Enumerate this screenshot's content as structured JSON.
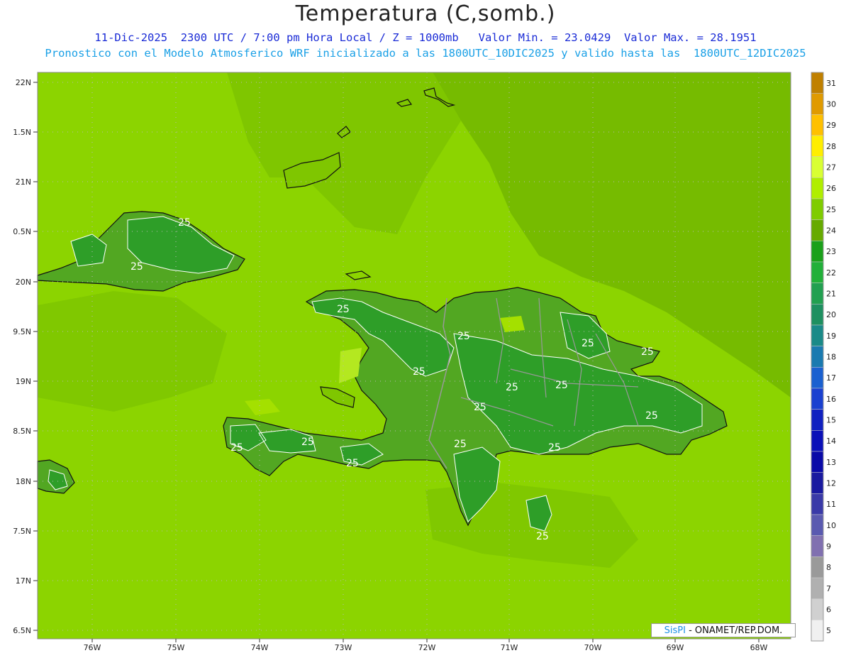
{
  "title": "Temperatura (C,somb.)",
  "subtitle1": "11-Dic-2025  2300 UTC / 7:00 pm Hora Local / Z = 1000mb   Valor Min. = 23.0429  Valor Max. = 28.1951",
  "subtitle2": "Pronostico con el Modelo Atmosferico WRF inicializado a las 1800UTC_10DIC2025 y valido hasta las  1800UTC_12DIC2025",
  "lat_ticks": [
    "22N",
    "1.5N",
    "21N",
    "0.5N",
    "20N",
    "9.5N",
    "19N",
    "8.5N",
    "18N",
    "7.5N",
    "17N",
    "6.5N"
  ],
  "lon_ticks": [
    "76W",
    "75W",
    "74W",
    "73W",
    "72W",
    "71W",
    "70W",
    "69W",
    "68W"
  ],
  "contour_label": "25",
  "colorbar": {
    "levels": [
      "31",
      "30",
      "29",
      "28",
      "27",
      "26",
      "25",
      "24",
      "23",
      "22",
      "21",
      "20",
      "19",
      "18",
      "17",
      "16",
      "15",
      "14",
      "13",
      "12",
      "11",
      "10",
      "9",
      "8",
      "7",
      "6",
      "5"
    ],
    "colors": [
      "#c08000",
      "#e09a00",
      "#ffc000",
      "#ffee00",
      "#d9ff33",
      "#b0ee00",
      "#7fcc00",
      "#66aa00",
      "#1aa01a",
      "#22b039",
      "#22a050",
      "#1e9060",
      "#1a8a88",
      "#1a7ab0",
      "#1a60d0",
      "#1a40d0",
      "#1020c0",
      "#0a10b8",
      "#0a0aa8",
      "#1a1aa0",
      "#3a3aa8",
      "#5a5ab0",
      "#8070b0",
      "#9a9a9a",
      "#b0b0b0",
      "#d0d0d0",
      "#f0f0f0"
    ]
  },
  "colors": {
    "ocean": "#8cd400",
    "sea_warm": "#76bb00",
    "land": "#2e9e28",
    "land_light": "#52a722",
    "hot": "#b4e820"
  },
  "credit": {
    "brand": "SisPI",
    "rest": "- ONAMET/REP.DOM."
  }
}
